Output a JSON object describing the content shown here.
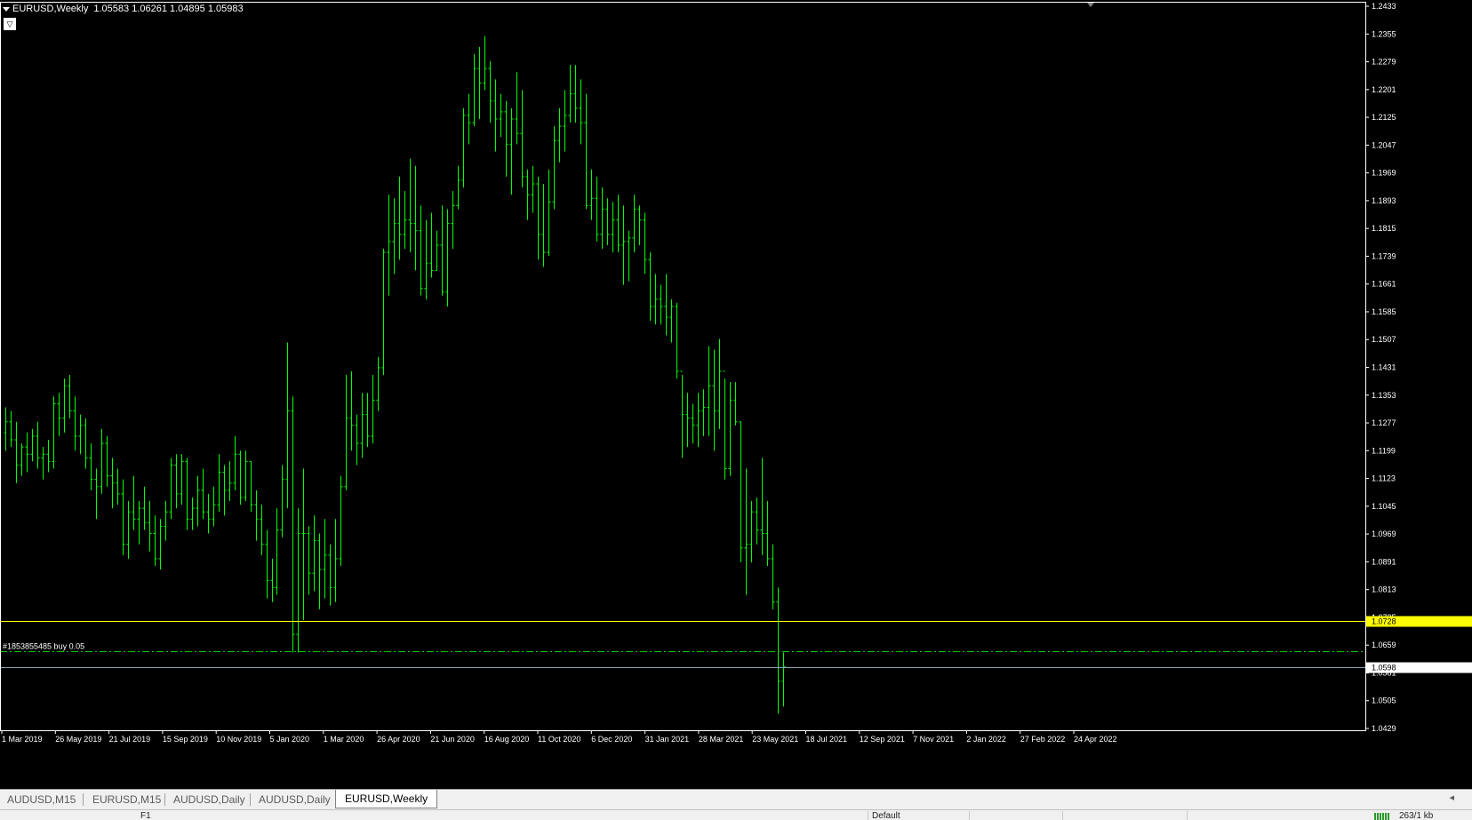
{
  "chart": {
    "symbol_timeframe": "EURUSD,Weekly",
    "ohlc_text": "1.05583 1.06261 1.04895 1.05983",
    "indicator_toggle": "▽",
    "colors": {
      "background": "#000000",
      "bars": "#00ff00",
      "axis_text": "#ffffff",
      "ask_line": "#ffff00",
      "bid_line": "#8ea4b8",
      "order_line": "#00cc00"
    },
    "price_scale_labels": [
      "1.2433",
      "1.2355",
      "1.2279",
      "1.2201",
      "1.2125",
      "1.2047",
      "1.1969",
      "1.1893",
      "1.1815",
      "1.1739",
      "1.1661",
      "1.1585",
      "1.1507",
      "1.1431",
      "1.1353",
      "1.1277",
      "1.1199",
      "1.1123",
      "1.1045",
      "1.0969",
      "1.0891",
      "1.0813",
      "1.0735",
      "1.0659",
      "1.0581",
      "1.0505",
      "1.0429"
    ],
    "y_range": [
      1.0429,
      1.2433
    ],
    "time_labels": [
      "1 Mar 2019",
      "26 May 2019",
      "21 Jul 2019",
      "15 Sep 2019",
      "10 Nov 2019",
      "5 Jan 2020",
      "1 Mar 2020",
      "26 Apr 2020",
      "21 Jun 2020",
      "16 Aug 2020",
      "11 Oct 2020",
      "6 Dec 2020",
      "31 Jan 2021",
      "28 Mar 2021",
      "23 May 2021",
      "18 Jul 2021",
      "12 Sep 2021",
      "7 Nov 2021",
      "2 Jan 2022",
      "27 Feb 2022",
      "24 Apr 2022"
    ],
    "ask_line": {
      "price": 1.0728,
      "label": "1.0728"
    },
    "bid_line": {
      "price": 1.0598,
      "label": "1.0598"
    },
    "order_line": {
      "price": 1.0643,
      "label": "#1853855485 buy 0.05"
    }
  },
  "chart_data": {
    "type": "ohlc",
    "title": "EURUSD,Weekly",
    "ylim": [
      1.0429,
      1.2433
    ],
    "series": [
      {
        "name": "EURUSD",
        "values": [
          [
            1.125,
            1.132,
            1.12,
            1.128
          ],
          [
            1.128,
            1.131,
            1.121,
            1.123
          ],
          [
            1.123,
            1.128,
            1.111,
            1.116
          ],
          [
            1.116,
            1.122,
            1.113,
            1.121
          ],
          [
            1.121,
            1.125,
            1.114,
            1.119
          ],
          [
            1.119,
            1.126,
            1.117,
            1.124
          ],
          [
            1.124,
            1.128,
            1.115,
            1.118
          ],
          [
            1.118,
            1.121,
            1.112,
            1.119
          ],
          [
            1.119,
            1.123,
            1.114,
            1.117
          ],
          [
            1.117,
            1.135,
            1.115,
            1.133
          ],
          [
            1.133,
            1.136,
            1.124,
            1.129
          ],
          [
            1.129,
            1.14,
            1.125,
            1.138
          ],
          [
            1.138,
            1.141,
            1.129,
            1.131
          ],
          [
            1.131,
            1.135,
            1.12,
            1.124
          ],
          [
            1.124,
            1.13,
            1.119,
            1.127
          ],
          [
            1.127,
            1.129,
            1.115,
            1.118
          ],
          [
            1.118,
            1.122,
            1.109,
            1.112
          ],
          [
            1.112,
            1.115,
            1.101,
            1.11
          ],
          [
            1.11,
            1.126,
            1.108,
            1.122
          ],
          [
            1.122,
            1.124,
            1.11,
            1.113
          ],
          [
            1.113,
            1.118,
            1.104,
            1.111
          ],
          [
            1.111,
            1.115,
            1.105,
            1.108
          ],
          [
            1.108,
            1.112,
            1.091,
            1.094
          ],
          [
            1.094,
            1.106,
            1.09,
            1.103
          ],
          [
            1.103,
            1.113,
            1.098,
            1.101
          ],
          [
            1.101,
            1.106,
            1.094,
            1.104
          ],
          [
            1.104,
            1.11,
            1.098,
            1.1
          ],
          [
            1.1,
            1.106,
            1.092,
            1.097
          ],
          [
            1.097,
            1.102,
            1.088,
            1.09
          ],
          [
            1.09,
            1.101,
            1.087,
            1.099
          ],
          [
            1.099,
            1.106,
            1.095,
            1.103
          ],
          [
            1.103,
            1.118,
            1.101,
            1.116
          ],
          [
            1.116,
            1.119,
            1.104,
            1.108
          ],
          [
            1.108,
            1.119,
            1.105,
            1.117
          ],
          [
            1.117,
            1.118,
            1.098,
            1.101
          ],
          [
            1.101,
            1.107,
            1.098,
            1.104
          ],
          [
            1.104,
            1.113,
            1.099,
            1.109
          ],
          [
            1.109,
            1.115,
            1.101,
            1.103
          ],
          [
            1.103,
            1.108,
            1.097,
            1.101
          ],
          [
            1.101,
            1.11,
            1.099,
            1.105
          ],
          [
            1.105,
            1.119,
            1.103,
            1.114
          ],
          [
            1.114,
            1.116,
            1.102,
            1.109
          ],
          [
            1.109,
            1.117,
            1.106,
            1.111
          ],
          [
            1.111,
            1.124,
            1.109,
            1.119
          ],
          [
            1.119,
            1.12,
            1.105,
            1.107
          ],
          [
            1.107,
            1.12,
            1.106,
            1.117
          ],
          [
            1.117,
            1.117,
            1.103,
            1.105
          ],
          [
            1.105,
            1.109,
            1.095,
            1.101
          ],
          [
            1.101,
            1.105,
            1.091,
            1.094
          ],
          [
            1.094,
            1.098,
            1.079,
            1.084
          ],
          [
            1.084,
            1.09,
            1.078,
            1.082
          ],
          [
            1.082,
            1.104,
            1.08,
            1.098
          ],
          [
            1.098,
            1.116,
            1.096,
            1.112
          ],
          [
            1.112,
            1.15,
            1.104,
            1.131
          ],
          [
            1.131,
            1.135,
            1.064,
            1.069
          ],
          [
            1.069,
            1.104,
            1.064,
            1.097
          ],
          [
            1.097,
            1.115,
            1.073,
            1.097
          ],
          [
            1.097,
            1.099,
            1.08,
            1.086
          ],
          [
            1.086,
            1.102,
            1.081,
            1.095
          ],
          [
            1.095,
            1.097,
            1.076,
            1.087
          ],
          [
            1.087,
            1.101,
            1.079,
            1.091
          ],
          [
            1.091,
            1.094,
            1.077,
            1.082
          ],
          [
            1.082,
            1.101,
            1.078,
            1.09
          ],
          [
            1.09,
            1.113,
            1.088,
            1.11
          ],
          [
            1.11,
            1.141,
            1.109,
            1.129
          ],
          [
            1.129,
            1.142,
            1.12,
            1.127
          ],
          [
            1.127,
            1.13,
            1.116,
            1.122
          ],
          [
            1.122,
            1.136,
            1.118,
            1.13
          ],
          [
            1.13,
            1.136,
            1.121,
            1.124
          ],
          [
            1.124,
            1.141,
            1.122,
            1.134
          ],
          [
            1.134,
            1.146,
            1.131,
            1.143
          ],
          [
            1.143,
            1.176,
            1.141,
            1.175
          ],
          [
            1.175,
            1.191,
            1.163,
            1.178
          ],
          [
            1.178,
            1.19,
            1.169,
            1.183
          ],
          [
            1.183,
            1.196,
            1.173,
            1.18
          ],
          [
            1.18,
            1.192,
            1.176,
            1.184
          ],
          [
            1.184,
            1.201,
            1.175,
            1.183
          ],
          [
            1.183,
            1.199,
            1.17,
            1.181
          ],
          [
            1.181,
            1.188,
            1.163,
            1.165
          ],
          [
            1.165,
            1.184,
            1.162,
            1.172
          ],
          [
            1.172,
            1.186,
            1.168,
            1.17
          ],
          [
            1.17,
            1.181,
            1.17,
            1.177
          ],
          [
            1.177,
            1.188,
            1.163,
            1.164
          ],
          [
            1.164,
            1.187,
            1.16,
            1.183
          ],
          [
            1.183,
            1.192,
            1.176,
            1.188
          ],
          [
            1.188,
            1.199,
            1.187,
            1.195
          ],
          [
            1.195,
            1.215,
            1.193,
            1.213
          ],
          [
            1.213,
            1.219,
            1.205,
            1.211
          ],
          [
            1.211,
            1.23,
            1.21,
            1.226
          ],
          [
            1.226,
            1.232,
            1.212,
            1.222
          ],
          [
            1.222,
            1.235,
            1.22,
            1.226
          ],
          [
            1.226,
            1.228,
            1.211,
            1.217
          ],
          [
            1.217,
            1.223,
            1.203,
            1.212
          ],
          [
            1.212,
            1.219,
            1.207,
            1.214
          ],
          [
            1.214,
            1.217,
            1.196,
            1.205
          ],
          [
            1.205,
            1.215,
            1.191,
            1.212
          ],
          [
            1.212,
            1.225,
            1.205,
            1.208
          ],
          [
            1.208,
            1.22,
            1.193,
            1.196
          ],
          [
            1.196,
            1.198,
            1.184,
            1.191
          ],
          [
            1.191,
            1.199,
            1.186,
            1.194
          ],
          [
            1.194,
            1.196,
            1.173,
            1.18
          ],
          [
            1.18,
            1.194,
            1.171,
            1.175
          ],
          [
            1.175,
            1.198,
            1.174,
            1.189
          ],
          [
            1.189,
            1.21,
            1.187,
            1.206
          ],
          [
            1.206,
            1.215,
            1.2,
            1.21
          ],
          [
            1.21,
            1.22,
            1.203,
            1.213
          ],
          [
            1.213,
            1.227,
            1.211,
            1.219
          ],
          [
            1.219,
            1.227,
            1.211,
            1.215
          ],
          [
            1.215,
            1.223,
            1.205,
            1.211
          ],
          [
            1.211,
            1.219,
            1.187,
            1.188
          ],
          [
            1.188,
            1.198,
            1.184,
            1.19
          ],
          [
            1.19,
            1.196,
            1.178,
            1.18
          ],
          [
            1.18,
            1.193,
            1.176,
            1.187
          ],
          [
            1.187,
            1.19,
            1.177,
            1.18
          ],
          [
            1.18,
            1.189,
            1.175,
            1.184
          ],
          [
            1.184,
            1.191,
            1.175,
            1.177
          ],
          [
            1.177,
            1.188,
            1.166,
            1.178
          ],
          [
            1.178,
            1.181,
            1.167,
            1.179
          ],
          [
            1.179,
            1.191,
            1.175,
            1.187
          ],
          [
            1.187,
            1.188,
            1.177,
            1.184
          ],
          [
            1.184,
            1.186,
            1.169,
            1.173
          ],
          [
            1.173,
            1.175,
            1.156,
            1.16
          ],
          [
            1.16,
            1.169,
            1.155,
            1.162
          ],
          [
            1.162,
            1.166,
            1.155,
            1.16
          ],
          [
            1.16,
            1.169,
            1.152,
            1.157
          ],
          [
            1.157,
            1.162,
            1.15,
            1.16
          ],
          [
            1.16,
            1.161,
            1.14,
            1.142
          ],
          [
            1.142,
            1.141,
            1.118,
            1.13
          ],
          [
            1.13,
            1.136,
            1.121,
            1.129
          ],
          [
            1.129,
            1.133,
            1.122,
            1.127
          ],
          [
            1.127,
            1.136,
            1.121,
            1.131
          ],
          [
            1.131,
            1.137,
            1.124,
            1.132
          ],
          [
            1.132,
            1.149,
            1.124,
            1.138
          ],
          [
            1.138,
            1.148,
            1.12,
            1.131
          ],
          [
            1.131,
            1.151,
            1.126,
            1.142
          ],
          [
            1.142,
            1.14,
            1.112,
            1.115
          ],
          [
            1.115,
            1.139,
            1.113,
            1.134
          ],
          [
            1.134,
            1.139,
            1.127,
            1.128
          ],
          [
            1.128,
            1.128,
            1.089,
            1.093
          ],
          [
            1.093,
            1.115,
            1.08,
            1.094
          ],
          [
            1.094,
            1.106,
            1.089,
            1.103
          ],
          [
            1.103,
            1.107,
            1.094,
            1.098
          ],
          [
            1.098,
            1.118,
            1.091,
            1.097
          ],
          [
            1.097,
            1.106,
            1.088,
            1.09
          ],
          [
            1.09,
            1.094,
            1.076,
            1.078
          ],
          [
            1.078,
            1.082,
            1.047,
            1.056
          ],
          [
            1.056,
            1.064,
            1.049,
            1.06
          ]
        ]
      }
    ]
  },
  "tabs": [
    {
      "label": "AUDUSD,M15"
    },
    {
      "label": "EURUSD,M15"
    },
    {
      "label": "AUDUSD,Daily"
    },
    {
      "label": "AUDUSD,Daily"
    },
    {
      "label": "EURUSD,Weekly",
      "active": true
    }
  ],
  "status_bar": {
    "help_hint": "F1",
    "profile": "Default",
    "connection_text": "263/1 kb"
  }
}
